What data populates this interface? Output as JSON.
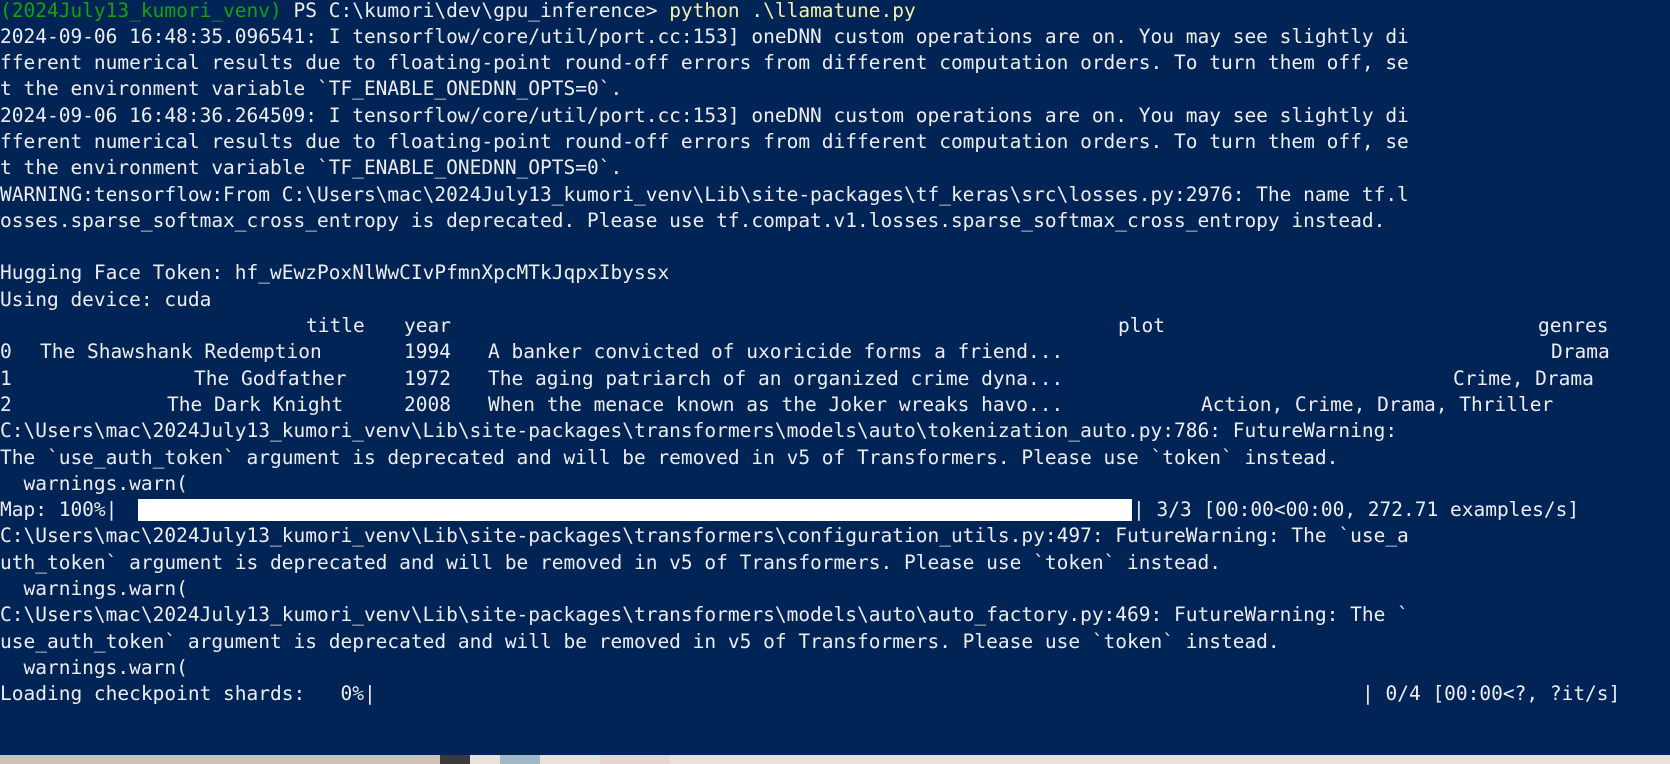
{
  "prompt": {
    "venv": "(2024July13_kumori_venv)",
    "ps": " PS C:\\kumori\\dev\\gpu_inference> ",
    "command": "python .\\llamatune.py"
  },
  "log_lines_1": [
    "2024-09-06 16:48:35.096541: I tensorflow/core/util/port.cc:153] oneDNN custom operations are on. You may see slightly di",
    "fferent numerical results due to floating-point round-off errors from different computation orders. To turn them off, se",
    "t the environment variable `TF_ENABLE_ONEDNN_OPTS=0`.",
    "2024-09-06 16:48:36.264509: I tensorflow/core/util/port.cc:153] oneDNN custom operations are on. You may see slightly di",
    "fferent numerical results due to floating-point round-off errors from different computation orders. To turn them off, se",
    "t the environment variable `TF_ENABLE_ONEDNN_OPTS=0`.",
    "WARNING:tensorflow:From C:\\Users\\mac\\2024July13_kumori_venv\\Lib\\site-packages\\tf_keras\\src\\losses.py:2976: The name tf.l",
    "osses.sparse_softmax_cross_entropy is deprecated. Please use tf.compat.v1.losses.sparse_softmax_cross_entropy instead.",
    "",
    "Hugging Face Token: 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",
    "Using device: cuda"
  ],
  "table": {
    "headers": [
      "title",
      "year",
      "plot",
      "genres"
    ],
    "rows": [
      {
        "index": "0",
        "title": "The Shawshank Redemption",
        "year": "1994",
        "plot": "A banker convicted of uxoricide forms a friend...",
        "genres": "Drama"
      },
      {
        "index": "1",
        "title": "The Godfather",
        "year": "1972",
        "plot": "The aging patriarch of an organized crime dyna...",
        "genres": "Crime, Drama"
      },
      {
        "index": "2",
        "title": "The Dark Knight",
        "year": "2008",
        "plot": "When the menace known as the Joker wreaks havo...",
        "genres": "Action, Crime, Drama, Thriller"
      }
    ]
  },
  "log_lines_2": [
    "C:\\Users\\mac\\2024July13_kumori_venv\\Lib\\site-packages\\transformers\\models\\auto\\tokenization_auto.py:786: FutureWarning:",
    "The `use_auth_token` argument is deprecated and will be removed in v5 of Transformers. Please use `token` instead.",
    "  warnings.warn("
  ],
  "map_progress": {
    "prefix": "Map: 100%|",
    "fraction": 1.0,
    "suffix": "| 3/3 [00:00<00:00, 272.71 examples/s]"
  },
  "log_lines_3": [
    "C:\\Users\\mac\\2024July13_kumori_venv\\Lib\\site-packages\\transformers\\configuration_utils.py:497: FutureWarning: The `use_a",
    "uth_token` argument is deprecated and will be removed in v5 of Transformers. Please use `token` instead.",
    "  warnings.warn(",
    "C:\\Users\\mac\\2024July13_kumori_venv\\Lib\\site-packages\\transformers\\models\\auto\\auto_factory.py:469: FutureWarning: The `",
    "use_auth_token` argument is deprecated and will be removed in v5 of Transformers. Please use `token` instead.",
    "  warnings.warn("
  ],
  "shards_progress": {
    "prefix": "Loading checkpoint shards:   0%|",
    "fraction": 0.0,
    "suffix": "| 0/4 [00:00<?, ?it/s]"
  },
  "colors": {
    "background": "#012456",
    "text": "#eeedf0",
    "venv": "#13a10e",
    "command": "#f9f1a5",
    "progress_fill": "#ffffff"
  }
}
